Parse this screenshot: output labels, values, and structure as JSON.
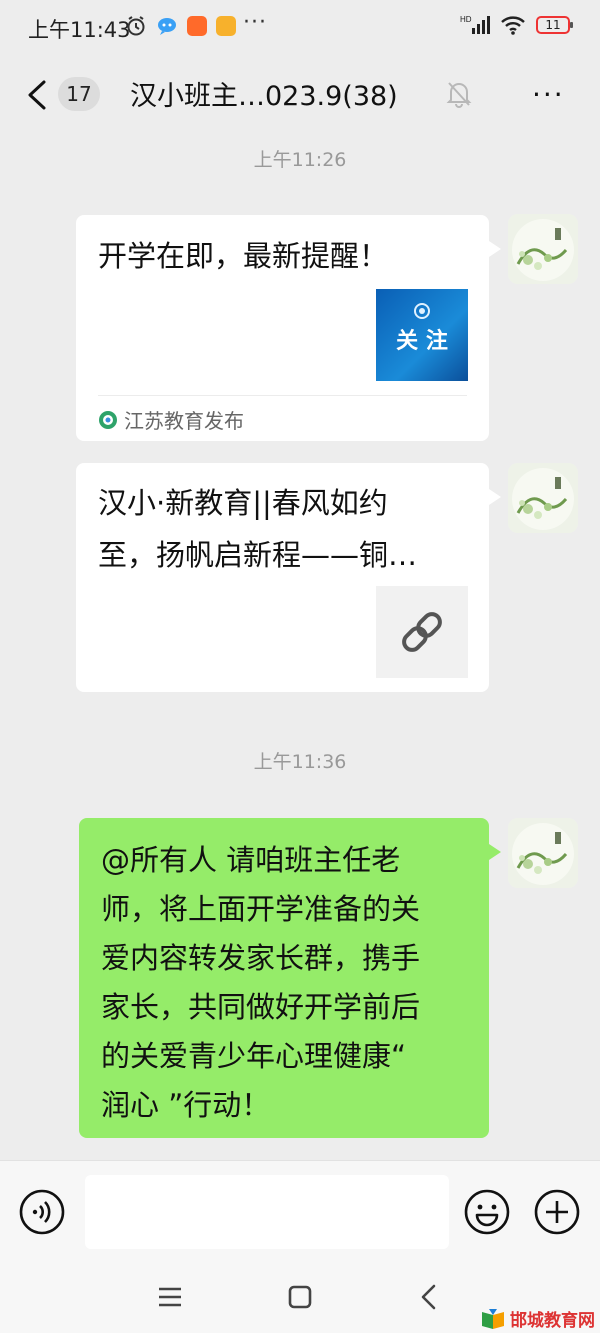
{
  "status_bar": {
    "time": "上午11:43",
    "more_dots": "···",
    "network_label": "HD",
    "battery_level": "11"
  },
  "header": {
    "unread_count": "17",
    "chat_title": "汉小班主…023.9(38)",
    "more_dots": "···"
  },
  "messages": [
    {
      "type": "time",
      "text": "上午11:26"
    },
    {
      "type": "card",
      "title": "开学在即，最新提醒！",
      "thumb_text": "关 注",
      "source": "江苏教育发布"
    },
    {
      "type": "card",
      "title_lines": [
        "汉小·新教育||春风如约",
        "至，扬帆启新程——铜…"
      ]
    },
    {
      "type": "time",
      "text": "上午11:36"
    },
    {
      "type": "text",
      "lines": [
        "@所有人  请咱班主任老",
        "师，将上面开学准备的关",
        "爱内容转发家长群，携手",
        "家长，共同做好开学前后",
        "的关爱青少年心理健康“",
        "润心 ”行动！"
      ]
    }
  ],
  "input_bar": {
    "placeholder": ""
  },
  "watermark": {
    "text": "邯城教育网"
  },
  "colors": {
    "background": "#ededed",
    "bubble_green": "#95ec69",
    "card_white": "#ffffff",
    "time_gray": "#999999",
    "battery_red": "#e33333"
  }
}
